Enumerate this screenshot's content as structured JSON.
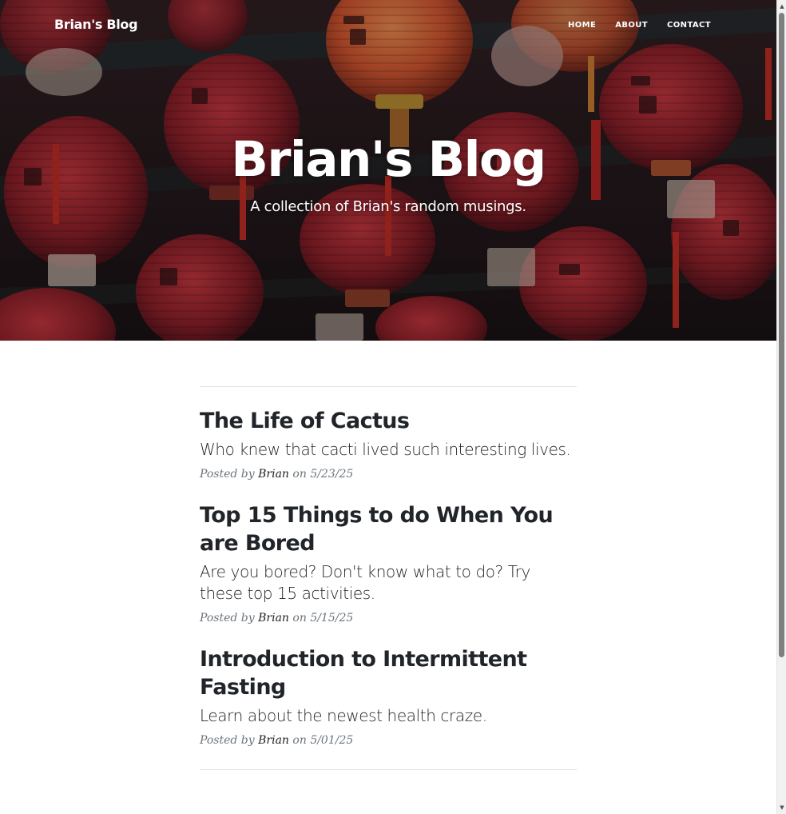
{
  "nav": {
    "brand": "Brian's Blog",
    "links": [
      "HOME",
      "ABOUT",
      "CONTACT"
    ]
  },
  "hero": {
    "title": "Brian's Blog",
    "subtitle": "A collection of Brian's random musings."
  },
  "posts": [
    {
      "title": "The Life of Cactus",
      "subtitle": "Who knew that cacti lived such interesting lives.",
      "meta_prefix": "Posted by",
      "author": "Brian",
      "meta_on": "on",
      "date": "5/23/25"
    },
    {
      "title": "Top 15 Things to do When You are Bored",
      "subtitle": "Are you bored? Don't know what to do? Try these top 15 activities.",
      "meta_prefix": "Posted by",
      "author": "Brian",
      "meta_on": "on",
      "date": "5/15/25"
    },
    {
      "title": "Introduction to Intermittent Fasting",
      "subtitle": "Learn about the newest health craze.",
      "meta_prefix": "Posted by",
      "author": "Brian",
      "meta_on": "on",
      "date": "5/01/25"
    }
  ],
  "colors": {
    "heading_text": "#212529",
    "meta_text": "#6c757d",
    "lantern_red": "#a8222a",
    "lantern_orange": "#d8552a"
  }
}
